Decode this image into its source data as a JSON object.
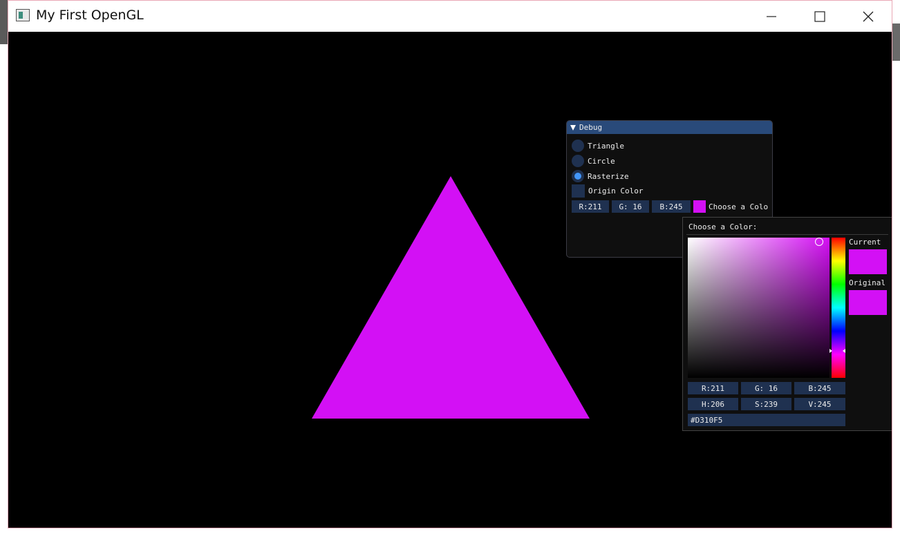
{
  "window": {
    "title": "My First OpenGL",
    "controls": [
      "minimize",
      "maximize",
      "close"
    ]
  },
  "scene": {
    "shape": "triangle",
    "fill_color": "#D310F5"
  },
  "debug_panel": {
    "title": "Debug",
    "options": [
      {
        "label": "Triangle",
        "selected": false
      },
      {
        "label": "Circle",
        "selected": false
      },
      {
        "label": "Rasterize",
        "selected": true
      }
    ],
    "origin_color": {
      "label": "Origin Color",
      "checked": false
    },
    "color_edit": {
      "r": "R:211",
      "g": "G: 16",
      "b": "B:245",
      "swatch_color": "#D310F5",
      "label": "Choose a Colo"
    }
  },
  "color_picker": {
    "title": "Choose a Color:",
    "current_label": "Current",
    "original_label": "Original",
    "current_color": "#D310F5",
    "original_color": "#D310F5",
    "rgb": {
      "r": "R:211",
      "g": "G: 16",
      "b": "B:245"
    },
    "hsv": {
      "h": "H:206",
      "s": "S:239",
      "v": "V:245"
    },
    "hex": "#D310F5"
  },
  "colors": {
    "panel_bg": "#0F0F0F",
    "title_active": "#294A7A",
    "frame_bg": "#1F3150",
    "accent": "#4296FA"
  }
}
